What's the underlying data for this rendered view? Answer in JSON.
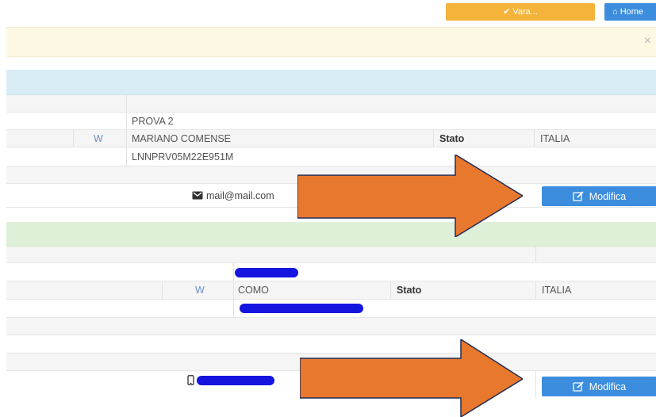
{
  "toolbar": {
    "yellow_button_label": "✔ Vara...",
    "home_button_label": "⌂ Home"
  },
  "alert": {
    "close_glyph": "×"
  },
  "record1": {
    "name": "PROVA 2",
    "w_marker": "W",
    "city": "MARIANO COMENSE",
    "state_label": "Stato",
    "state_value": "ITALIA",
    "fiscal_code": "LNNPRV05M22E951M",
    "email": "mail@mail.com",
    "edit_label": "Modifica"
  },
  "record2": {
    "w_marker": "W",
    "city": "COMO",
    "state_label": "Stato",
    "state_value": "ITALIA",
    "edit_label": "Modifica"
  },
  "colors": {
    "orange_arrow": "#e8782d",
    "primary_button": "#3c8dde",
    "redaction": "#1515e0"
  }
}
